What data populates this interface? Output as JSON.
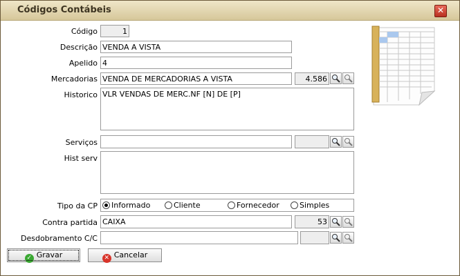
{
  "window": {
    "title": "Códigos Contábeis",
    "close_label": "✕"
  },
  "form": {
    "codigo": {
      "label": "Código",
      "value": "1"
    },
    "descricao": {
      "label": "Descrição",
      "value": "VENDA A VISTA"
    },
    "apelido": {
      "label": "Apelido",
      "value": "4"
    },
    "mercadorias": {
      "label": "Mercadorias",
      "value": "VENDA DE MERCADORIAS A VISTA",
      "code": "4.586"
    },
    "historico": {
      "label": "Historico",
      "value": "VLR VENDAS DE MERC.NF [N] DE [P]"
    },
    "servicos": {
      "label": "Serviços",
      "value": "",
      "code": ""
    },
    "hist_serv": {
      "label": "Hist serv",
      "value": ""
    },
    "tipo_cp": {
      "label": "Tipo da CP",
      "options": [
        "Informado",
        "Cliente",
        "Fornecedor",
        "Simples"
      ],
      "selected": "Informado"
    },
    "contra_partida": {
      "label": "Contra partida",
      "value": "CAIXA",
      "code": "53"
    },
    "desdobramento": {
      "label": "Desdobramento C/C",
      "value": "",
      "code": ""
    }
  },
  "buttons": {
    "gravar": "Gravar",
    "cancelar": "Cancelar"
  },
  "icons": {
    "lookup": "magnifier-icon",
    "clear": "clear-search-icon",
    "illustration": "spreadsheet-icon"
  }
}
